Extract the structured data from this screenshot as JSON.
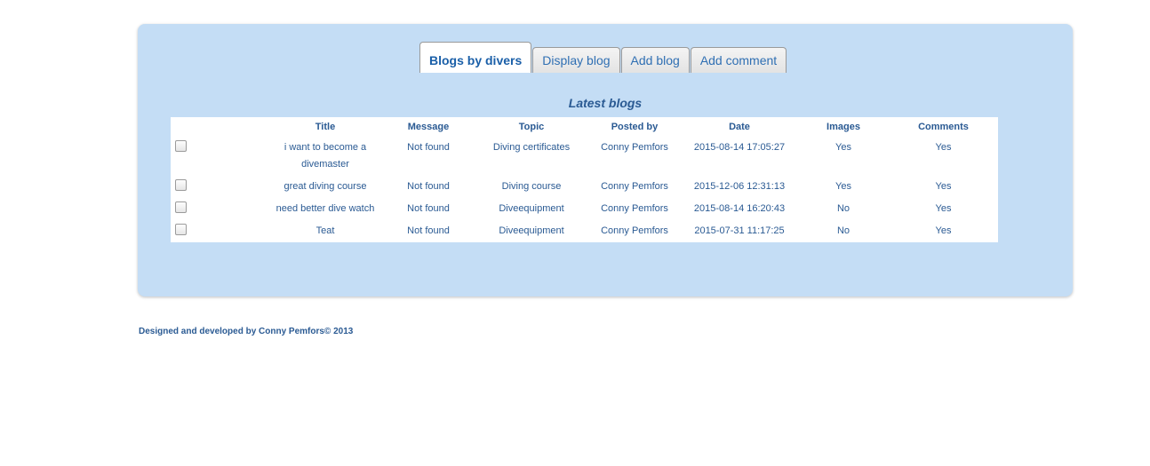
{
  "tabs": [
    {
      "label": "Blogs by divers",
      "active": true
    },
    {
      "label": "Display blog",
      "active": false
    },
    {
      "label": "Add blog",
      "active": false
    },
    {
      "label": "Add comment",
      "active": false
    }
  ],
  "caption": "Latest blogs",
  "table": {
    "headers": [
      "Title",
      "Message",
      "Topic",
      "Posted by",
      "Date",
      "Images",
      "Comments"
    ],
    "rows": [
      {
        "title": "i want to become a divemaster",
        "message": "Not found",
        "topic": "Diving certificates",
        "posted_by": "Conny Pemfors",
        "date": "2015-08-14 17:05:27",
        "images": "Yes",
        "comments": "Yes"
      },
      {
        "title": "great diving course",
        "message": "Not found",
        "topic": "Diving course",
        "posted_by": "Conny Pemfors",
        "date": "2015-12-06 12:31:13",
        "images": "Yes",
        "comments": "Yes"
      },
      {
        "title": "need better dive watch",
        "message": "Not found",
        "topic": "Diveequipment",
        "posted_by": "Conny Pemfors",
        "date": "2015-08-14 16:20:43",
        "images": "No",
        "comments": "Yes"
      },
      {
        "title": "Teat",
        "message": "Not found",
        "topic": "Diveequipment",
        "posted_by": "Conny Pemfors",
        "date": "2015-07-31 11:17:25",
        "images": "No",
        "comments": "Yes"
      }
    ]
  },
  "footer": "Designed and developed by Conny Pemfors© 2013"
}
